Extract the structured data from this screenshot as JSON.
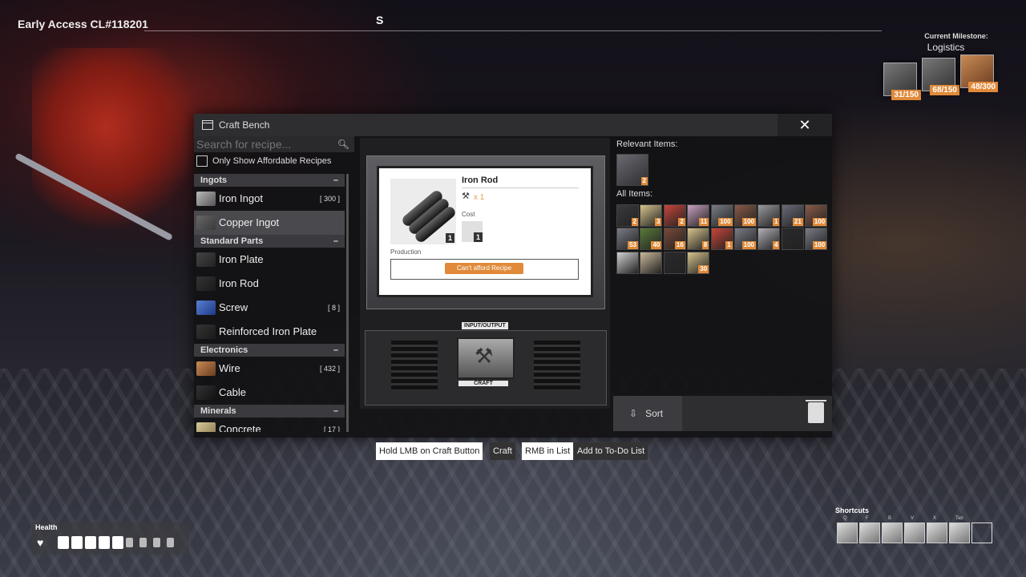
{
  "hud": {
    "version": "Early Access CL#118201",
    "compass": "S",
    "milestone": {
      "title": "Current Milestone:",
      "name": "Logistics",
      "items": [
        {
          "icon": "iron-plate-icon",
          "count": "31/150"
        },
        {
          "icon": "iron-rod-icon",
          "count": "68/150"
        },
        {
          "icon": "wire-icon",
          "count": "48/300"
        }
      ]
    },
    "health_label": "Health",
    "health": {
      "filled": 5,
      "total": 9
    },
    "shortcuts": {
      "label": "Shortcuts",
      "keys": [
        "Q",
        "F",
        "B",
        "V",
        "X",
        "Tab",
        ""
      ]
    }
  },
  "window": {
    "title": "Craft Bench",
    "close": "✕",
    "search_placeholder": "Search for recipe...",
    "affordable_label": "Only Show Affordable Recipes",
    "categories": [
      {
        "name": "Ingots",
        "collapse": "–",
        "items": [
          {
            "name": "Iron Ingot",
            "count": "[ 300 ]",
            "selected": false
          },
          {
            "name": "Copper Ingot",
            "count": "",
            "selected": true
          }
        ]
      },
      {
        "name": "Standard Parts",
        "collapse": "–",
        "items": [
          {
            "name": "Iron Plate",
            "count": ""
          },
          {
            "name": "Iron Rod",
            "count": ""
          },
          {
            "name": "Screw",
            "count": "[ 8 ]"
          },
          {
            "name": "Reinforced Iron Plate",
            "count": ""
          }
        ]
      },
      {
        "name": "Electronics",
        "collapse": "–",
        "items": [
          {
            "name": "Wire",
            "count": "[ 432 ]"
          },
          {
            "name": "Cable",
            "count": ""
          }
        ]
      },
      {
        "name": "Minerals",
        "collapse": "–",
        "items": [
          {
            "name": "Concrete",
            "count": "[ 17 ]"
          }
        ]
      }
    ],
    "recipe": {
      "name": "Iron Rod",
      "output_amount": "1",
      "multiplier": "x 1",
      "cost_label": "Cost",
      "cost_amount": "1",
      "production_label": "Production",
      "afford_button": "Can't afford Recipe",
      "io_label": "INPUT/OUTPUT",
      "craft_label": "CRAFT"
    },
    "relevant_label": "Relevant Items:",
    "relevant_items": [
      {
        "icon": "iron-rod-icon",
        "count": "2"
      }
    ],
    "all_label": "All Items:",
    "all_items": [
      {
        "icon": "iron-rod-icon",
        "count": "2"
      },
      {
        "icon": "limestone-icon",
        "count": "3"
      },
      {
        "icon": "flower-icon",
        "count": "2"
      },
      {
        "icon": "mycelia-icon",
        "count": "11"
      },
      {
        "icon": "iron-ore-icon",
        "count": "100"
      },
      {
        "icon": "copper-ore-icon",
        "count": "100"
      },
      {
        "icon": "iron-plate-icon",
        "count": "1"
      },
      {
        "icon": "screw-icon",
        "count": "21"
      },
      {
        "icon": "copper-ore-icon",
        "count": "100"
      },
      {
        "icon": "iron-ore-icon",
        "count": "53"
      },
      {
        "icon": "leaves-icon",
        "count": "40"
      },
      {
        "icon": "copper-ingot-icon",
        "count": "16"
      },
      {
        "icon": "limestone-icon",
        "count": "8"
      },
      {
        "icon": "flower-icon",
        "count": "1"
      },
      {
        "icon": "iron-ore-icon",
        "count": "100"
      },
      {
        "icon": "iron-ingot-icon",
        "count": "4"
      },
      {
        "icon": "empty-slot-icon",
        "count": ""
      },
      {
        "icon": "iron-ore-icon",
        "count": "100"
      },
      {
        "icon": "wrench-icon",
        "count": ""
      },
      {
        "icon": "figure-icon",
        "count": ""
      },
      {
        "icon": "empty-slot-icon",
        "count": ""
      },
      {
        "icon": "limestone-icon",
        "count": "30"
      }
    ],
    "sort_label": "Sort"
  },
  "hints": [
    {
      "key": "Hold LMB on Craft Button",
      "action": "Craft"
    },
    {
      "key": "RMB in List",
      "action": "Add to To-Do List"
    }
  ]
}
